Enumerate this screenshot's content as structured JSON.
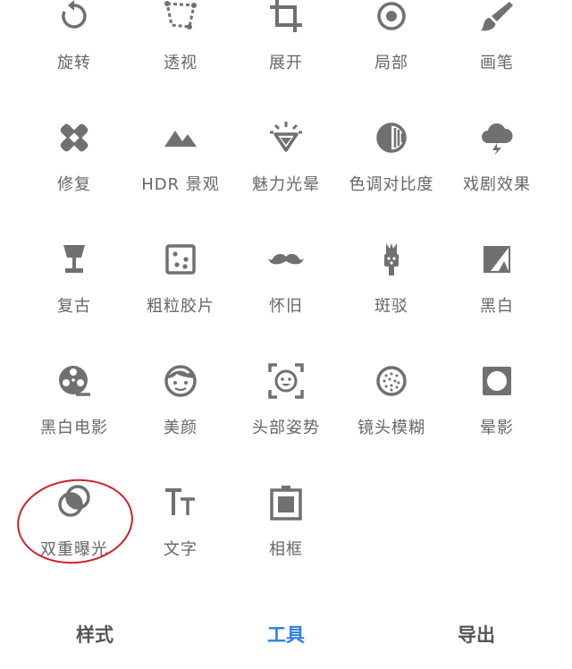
{
  "tools": [
    {
      "label": "旋转",
      "icon": "rotate-icon"
    },
    {
      "label": "透视",
      "icon": "perspective-icon"
    },
    {
      "label": "展开",
      "icon": "expand-crop-icon"
    },
    {
      "label": "局部",
      "icon": "selective-icon"
    },
    {
      "label": "画笔",
      "icon": "brush-icon"
    },
    {
      "label": "修复",
      "icon": "healing-icon"
    },
    {
      "label": "HDR 景观",
      "icon": "hdr-mountain-icon"
    },
    {
      "label": "魅力光晕",
      "icon": "glamour-glow-icon"
    },
    {
      "label": "色调对比度",
      "icon": "tonal-contrast-icon"
    },
    {
      "label": "戏剧效果",
      "icon": "drama-cloud-icon"
    },
    {
      "label": "复古",
      "icon": "vintage-lamp-icon"
    },
    {
      "label": "粗粒胶片",
      "icon": "grainy-film-icon"
    },
    {
      "label": "怀旧",
      "icon": "retrolux-mustache-icon"
    },
    {
      "label": "斑驳",
      "icon": "grunge-guitar-icon"
    },
    {
      "label": "黑白",
      "icon": "black-white-icon"
    },
    {
      "label": "黑白电影",
      "icon": "noir-film-reel-icon"
    },
    {
      "label": "美颜",
      "icon": "face-portrait-icon"
    },
    {
      "label": "头部姿势",
      "icon": "head-pose-icon"
    },
    {
      "label": "镜头模糊",
      "icon": "lens-blur-icon"
    },
    {
      "label": "晕影",
      "icon": "vignette-icon"
    },
    {
      "label": "双重曝光",
      "icon": "double-exposure-icon"
    },
    {
      "label": "文字",
      "icon": "text-icon"
    },
    {
      "label": "相框",
      "icon": "frames-icon"
    }
  ],
  "highlight": {
    "tool": "双重曝光",
    "color": "#d21f2b"
  },
  "bottom_tabs": [
    {
      "label": "样式",
      "active": false
    },
    {
      "label": "工具",
      "active": true
    },
    {
      "label": "导出",
      "active": false
    }
  ],
  "colors": {
    "icon": "#707070",
    "active_tab": "#2f7fe0",
    "tab": "#555555"
  }
}
